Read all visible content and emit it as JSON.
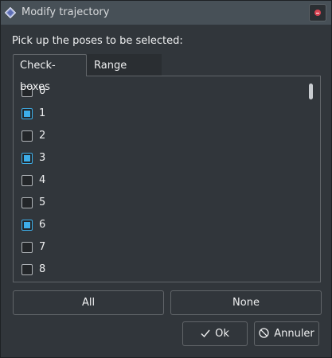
{
  "window": {
    "title": "Modify trajectory",
    "icon": "diamond-app-icon",
    "close_icon": "close-icon"
  },
  "prompt": "Pick up the poses to be selected:",
  "tabs": [
    {
      "label": "Check-boxes",
      "active": true
    },
    {
      "label": "Range select",
      "active": false
    }
  ],
  "poses": [
    {
      "label": "0",
      "checked": false
    },
    {
      "label": "1",
      "checked": true
    },
    {
      "label": "2",
      "checked": false
    },
    {
      "label": "3",
      "checked": true
    },
    {
      "label": "4",
      "checked": false
    },
    {
      "label": "5",
      "checked": false
    },
    {
      "label": "6",
      "checked": true
    },
    {
      "label": "7",
      "checked": false
    },
    {
      "label": "8",
      "checked": false
    }
  ],
  "buttons": {
    "all": "All",
    "none": "None",
    "ok": "Ok",
    "ok_icon": "checkmark-icon",
    "cancel": "Annuler",
    "cancel_icon": "cancel-icon"
  },
  "colors": {
    "accent": "#3daee9",
    "background": "#31363b",
    "titlebar": "#475057",
    "close": "#da4453"
  }
}
